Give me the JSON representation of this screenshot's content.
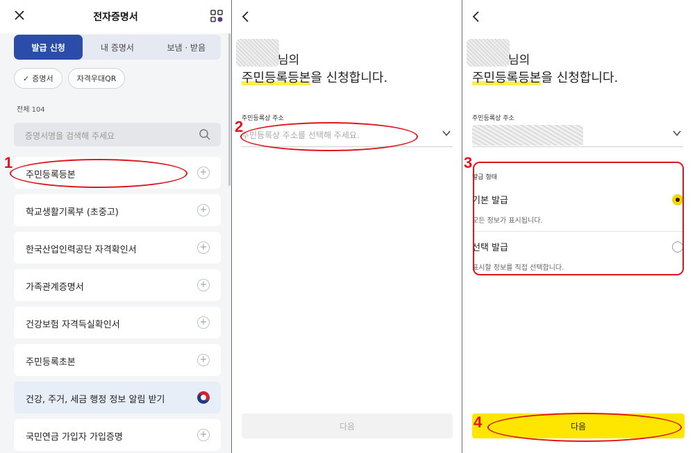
{
  "panel1": {
    "title": "전자증명서",
    "tabs": [
      {
        "label": "발급 신청",
        "active": true
      },
      {
        "label": "내 증명서",
        "active": false
      },
      {
        "label": "보냄 · 받음",
        "active": false
      }
    ],
    "chips": [
      {
        "label": "증명서",
        "checked": true
      },
      {
        "label": "자격우대QR",
        "checked": false
      }
    ],
    "total": "전체 104",
    "search_placeholder": "증명서명을 검색해 주세요",
    "items": [
      {
        "label": "주민등록등본",
        "action": "plus"
      },
      {
        "label": "학교생활기록부 (초중고)",
        "action": "plus"
      },
      {
        "label": "한국산업인력공단 자격확인서",
        "action": "plus"
      },
      {
        "label": "가족관계증명서",
        "action": "plus"
      },
      {
        "label": "건강보험 자격득실확인서",
        "action": "plus"
      },
      {
        "label": "주민등록초본",
        "action": "plus"
      },
      {
        "label": "건강, 주거, 세금 행정 정보 알림 받기",
        "action": "gov"
      },
      {
        "label": "국민연금 가입자 가입증명",
        "action": "plus"
      }
    ]
  },
  "panel2": {
    "greeting": "님의",
    "headline_highlight": "주민등록등본",
    "headline_rest": "을 신청합니다.",
    "field_label": "주민등록상 주소",
    "field_placeholder": "주민등록상 주소를 선택해 주세요.",
    "next_button": "다음"
  },
  "panel3": {
    "greeting": "님의",
    "headline_highlight": "주민등록등본",
    "headline_rest": "을 신청합니다.",
    "field_label": "주민등록상 주소",
    "type_label": "발급 형태",
    "options": [
      {
        "title": "기본 발급",
        "desc": "모든 정보가 표시됩니다.",
        "selected": true
      },
      {
        "title": "선택 발급",
        "desc": "표시할 정보를 직접 선택합니다.",
        "selected": false
      }
    ],
    "next_button": "다음"
  },
  "annotations": [
    "1",
    "2",
    "3",
    "4"
  ],
  "colors": {
    "primary": "#2b4ca8",
    "accent_yellow": "#ffe600",
    "annotation_red": "#e0141c"
  }
}
